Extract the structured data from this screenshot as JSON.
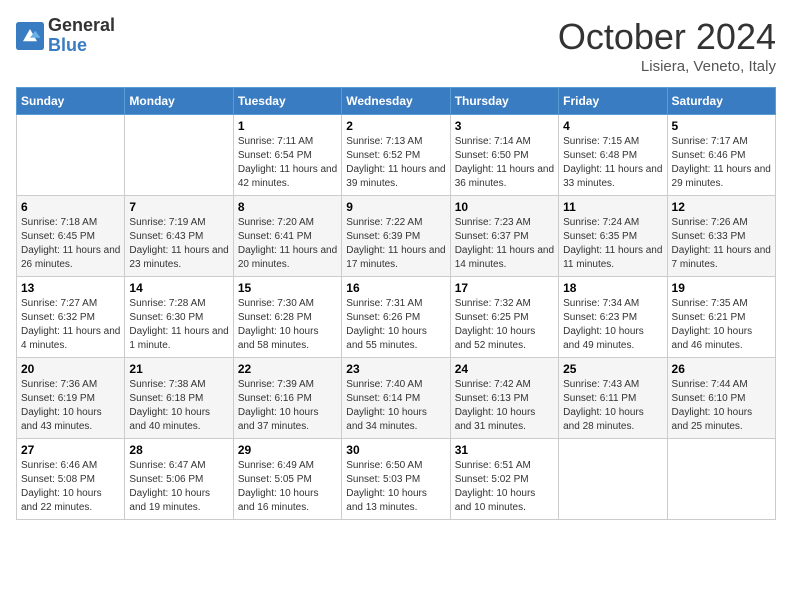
{
  "logo": {
    "line1": "General",
    "line2": "Blue"
  },
  "header": {
    "month": "October 2024",
    "location": "Lisiera, Veneto, Italy"
  },
  "weekdays": [
    "Sunday",
    "Monday",
    "Tuesday",
    "Wednesday",
    "Thursday",
    "Friday",
    "Saturday"
  ],
  "weeks": [
    [
      {
        "day": "",
        "sunrise": "",
        "sunset": "",
        "daylight": ""
      },
      {
        "day": "",
        "sunrise": "",
        "sunset": "",
        "daylight": ""
      },
      {
        "day": "1",
        "sunrise": "Sunrise: 7:11 AM",
        "sunset": "Sunset: 6:54 PM",
        "daylight": "Daylight: 11 hours and 42 minutes."
      },
      {
        "day": "2",
        "sunrise": "Sunrise: 7:13 AM",
        "sunset": "Sunset: 6:52 PM",
        "daylight": "Daylight: 11 hours and 39 minutes."
      },
      {
        "day": "3",
        "sunrise": "Sunrise: 7:14 AM",
        "sunset": "Sunset: 6:50 PM",
        "daylight": "Daylight: 11 hours and 36 minutes."
      },
      {
        "day": "4",
        "sunrise": "Sunrise: 7:15 AM",
        "sunset": "Sunset: 6:48 PM",
        "daylight": "Daylight: 11 hours and 33 minutes."
      },
      {
        "day": "5",
        "sunrise": "Sunrise: 7:17 AM",
        "sunset": "Sunset: 6:46 PM",
        "daylight": "Daylight: 11 hours and 29 minutes."
      }
    ],
    [
      {
        "day": "6",
        "sunrise": "Sunrise: 7:18 AM",
        "sunset": "Sunset: 6:45 PM",
        "daylight": "Daylight: 11 hours and 26 minutes."
      },
      {
        "day": "7",
        "sunrise": "Sunrise: 7:19 AM",
        "sunset": "Sunset: 6:43 PM",
        "daylight": "Daylight: 11 hours and 23 minutes."
      },
      {
        "day": "8",
        "sunrise": "Sunrise: 7:20 AM",
        "sunset": "Sunset: 6:41 PM",
        "daylight": "Daylight: 11 hours and 20 minutes."
      },
      {
        "day": "9",
        "sunrise": "Sunrise: 7:22 AM",
        "sunset": "Sunset: 6:39 PM",
        "daylight": "Daylight: 11 hours and 17 minutes."
      },
      {
        "day": "10",
        "sunrise": "Sunrise: 7:23 AM",
        "sunset": "Sunset: 6:37 PM",
        "daylight": "Daylight: 11 hours and 14 minutes."
      },
      {
        "day": "11",
        "sunrise": "Sunrise: 7:24 AM",
        "sunset": "Sunset: 6:35 PM",
        "daylight": "Daylight: 11 hours and 11 minutes."
      },
      {
        "day": "12",
        "sunrise": "Sunrise: 7:26 AM",
        "sunset": "Sunset: 6:33 PM",
        "daylight": "Daylight: 11 hours and 7 minutes."
      }
    ],
    [
      {
        "day": "13",
        "sunrise": "Sunrise: 7:27 AM",
        "sunset": "Sunset: 6:32 PM",
        "daylight": "Daylight: 11 hours and 4 minutes."
      },
      {
        "day": "14",
        "sunrise": "Sunrise: 7:28 AM",
        "sunset": "Sunset: 6:30 PM",
        "daylight": "Daylight: 11 hours and 1 minute."
      },
      {
        "day": "15",
        "sunrise": "Sunrise: 7:30 AM",
        "sunset": "Sunset: 6:28 PM",
        "daylight": "Daylight: 10 hours and 58 minutes."
      },
      {
        "day": "16",
        "sunrise": "Sunrise: 7:31 AM",
        "sunset": "Sunset: 6:26 PM",
        "daylight": "Daylight: 10 hours and 55 minutes."
      },
      {
        "day": "17",
        "sunrise": "Sunrise: 7:32 AM",
        "sunset": "Sunset: 6:25 PM",
        "daylight": "Daylight: 10 hours and 52 minutes."
      },
      {
        "day": "18",
        "sunrise": "Sunrise: 7:34 AM",
        "sunset": "Sunset: 6:23 PM",
        "daylight": "Daylight: 10 hours and 49 minutes."
      },
      {
        "day": "19",
        "sunrise": "Sunrise: 7:35 AM",
        "sunset": "Sunset: 6:21 PM",
        "daylight": "Daylight: 10 hours and 46 minutes."
      }
    ],
    [
      {
        "day": "20",
        "sunrise": "Sunrise: 7:36 AM",
        "sunset": "Sunset: 6:19 PM",
        "daylight": "Daylight: 10 hours and 43 minutes."
      },
      {
        "day": "21",
        "sunrise": "Sunrise: 7:38 AM",
        "sunset": "Sunset: 6:18 PM",
        "daylight": "Daylight: 10 hours and 40 minutes."
      },
      {
        "day": "22",
        "sunrise": "Sunrise: 7:39 AM",
        "sunset": "Sunset: 6:16 PM",
        "daylight": "Daylight: 10 hours and 37 minutes."
      },
      {
        "day": "23",
        "sunrise": "Sunrise: 7:40 AM",
        "sunset": "Sunset: 6:14 PM",
        "daylight": "Daylight: 10 hours and 34 minutes."
      },
      {
        "day": "24",
        "sunrise": "Sunrise: 7:42 AM",
        "sunset": "Sunset: 6:13 PM",
        "daylight": "Daylight: 10 hours and 31 minutes."
      },
      {
        "day": "25",
        "sunrise": "Sunrise: 7:43 AM",
        "sunset": "Sunset: 6:11 PM",
        "daylight": "Daylight: 10 hours and 28 minutes."
      },
      {
        "day": "26",
        "sunrise": "Sunrise: 7:44 AM",
        "sunset": "Sunset: 6:10 PM",
        "daylight": "Daylight: 10 hours and 25 minutes."
      }
    ],
    [
      {
        "day": "27",
        "sunrise": "Sunrise: 6:46 AM",
        "sunset": "Sunset: 5:08 PM",
        "daylight": "Daylight: 10 hours and 22 minutes."
      },
      {
        "day": "28",
        "sunrise": "Sunrise: 6:47 AM",
        "sunset": "Sunset: 5:06 PM",
        "daylight": "Daylight: 10 hours and 19 minutes."
      },
      {
        "day": "29",
        "sunrise": "Sunrise: 6:49 AM",
        "sunset": "Sunset: 5:05 PM",
        "daylight": "Daylight: 10 hours and 16 minutes."
      },
      {
        "day": "30",
        "sunrise": "Sunrise: 6:50 AM",
        "sunset": "Sunset: 5:03 PM",
        "daylight": "Daylight: 10 hours and 13 minutes."
      },
      {
        "day": "31",
        "sunrise": "Sunrise: 6:51 AM",
        "sunset": "Sunset: 5:02 PM",
        "daylight": "Daylight: 10 hours and 10 minutes."
      },
      {
        "day": "",
        "sunrise": "",
        "sunset": "",
        "daylight": ""
      },
      {
        "day": "",
        "sunrise": "",
        "sunset": "",
        "daylight": ""
      }
    ]
  ]
}
